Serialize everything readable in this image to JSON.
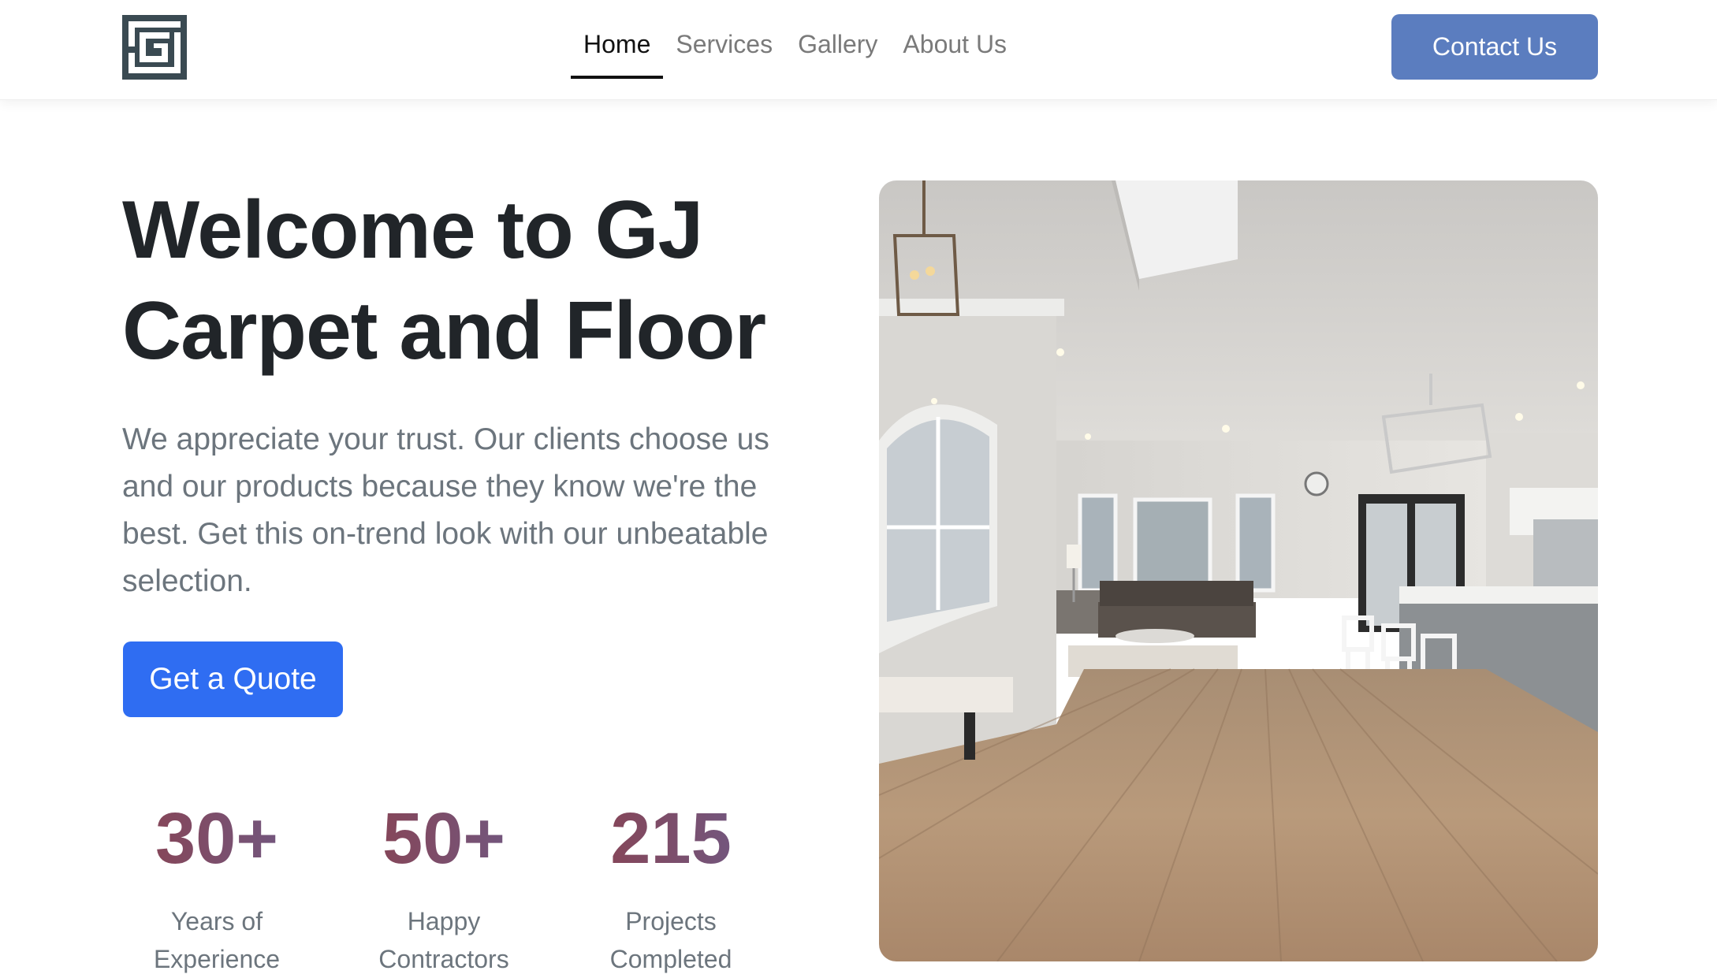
{
  "header": {
    "logo_alt": "GJ logo",
    "nav": [
      {
        "label": "Home",
        "active": true
      },
      {
        "label": "Services",
        "active": false
      },
      {
        "label": "Gallery",
        "active": false
      },
      {
        "label": "About Us",
        "active": false
      }
    ],
    "contact_label": "Contact Us"
  },
  "hero": {
    "title": "Welcome to GJ Carpet and Floor",
    "description": "We appreciate your trust. Our clients choose us and our products because they know we're the best. Get this on-trend look with our unbeatable selection.",
    "cta_label": "Get a Quote",
    "image_alt": "Bright open-plan living room and kitchen with light hardwood floor"
  },
  "stats": [
    {
      "number": "30+",
      "label": "Years of Experience"
    },
    {
      "number": "50+",
      "label": "Happy Contractors"
    },
    {
      "number": "215",
      "label": "Projects Completed"
    }
  ],
  "colors": {
    "primary": "#2f6df2",
    "contact": "#5b7dbf",
    "heading": "#212529",
    "muted": "#6c757d",
    "stat_gradient_start": "#8a4250",
    "stat_gradient_end": "#6e5a86"
  }
}
